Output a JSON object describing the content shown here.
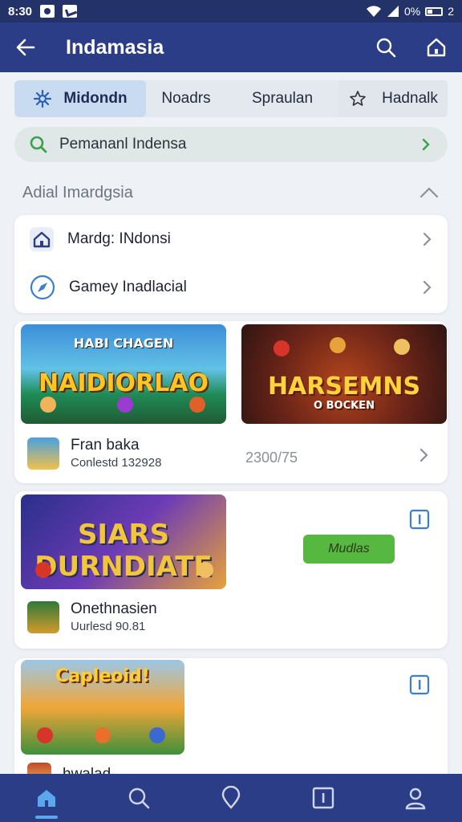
{
  "status_bar": {
    "time": "8:30",
    "battery": "0%",
    "sim": "2"
  },
  "app_bar": {
    "title": "Indamasia",
    "back_icon": "arrow-left-icon",
    "search_icon": "search-icon",
    "home_icon": "home-icon"
  },
  "tabs": [
    {
      "label": "Midondn",
      "icon": "gear-icon",
      "active": true
    },
    {
      "label": "Noadrs"
    },
    {
      "label": "Spraulan"
    },
    {
      "label": "Hadnalk",
      "icon": "star-outline-icon"
    }
  ],
  "search": {
    "text": "Pemananl Indensa"
  },
  "section": {
    "title": "Adial Imardgsia"
  },
  "list": [
    {
      "label": "Mardg: INdonsi",
      "icon": "house-icon"
    },
    {
      "label": "Gamey Inadlacial",
      "icon": "compass-icon"
    }
  ],
  "cards": [
    {
      "banner1_text": "NAIDIORLAO",
      "banner1_subtitle": "HABI CHAGEN",
      "banner2_text": "HARSEMNS",
      "banner2_subtitle": "O BOCKEN",
      "name": "Fran baka",
      "subtitle": "Conlestd 132928",
      "count": "2300/75"
    },
    {
      "banner_text": "SIARS DURNDIATE",
      "button_label": "Mudlas",
      "name": "Onethnasien",
      "subtitle": "Uurlesd 90.81"
    },
    {
      "banner_text": "Capleoid!",
      "name": "hwalad"
    }
  ],
  "bottom_nav": [
    {
      "icon": "home-icon",
      "active": true
    },
    {
      "icon": "search-icon"
    },
    {
      "icon": "location-icon"
    },
    {
      "icon": "info-square-icon"
    },
    {
      "icon": "profile-icon"
    }
  ],
  "colors": {
    "primary": "#2b3d86",
    "accent": "#56b840",
    "tab_active": "#c9dbf0"
  }
}
